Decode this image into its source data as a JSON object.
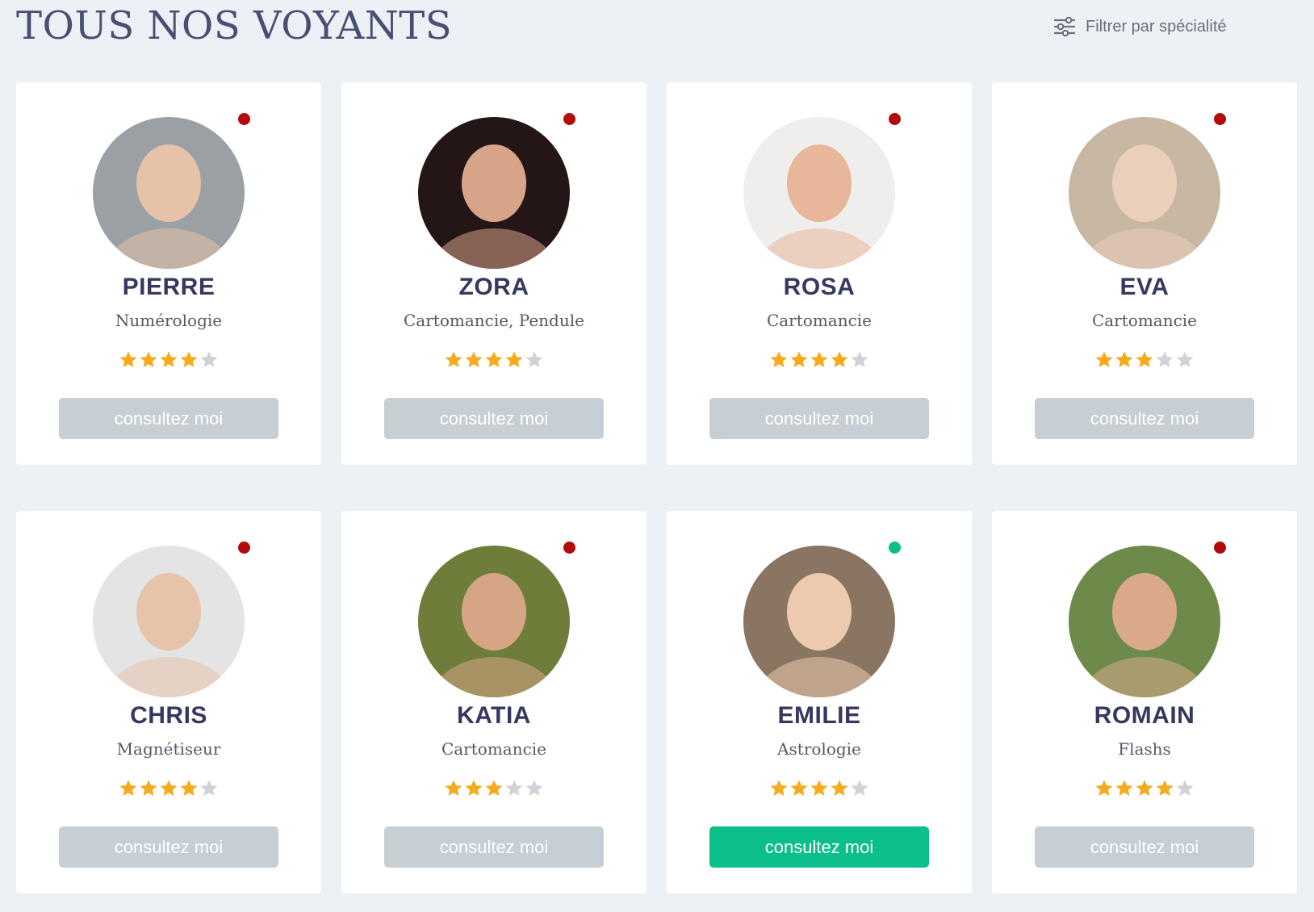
{
  "page": {
    "title": "TOUS NOS VOYANTS"
  },
  "filter": {
    "label": "Filtrer par spécialité",
    "icon": "sliders-icon"
  },
  "colors": {
    "online": "#0bbf8a",
    "offline": "#b30b0b",
    "button_active": "#0bbf8a",
    "button_inactive": "#c7cfd4",
    "star_filled": "#f6aa1c",
    "star_empty": "#cfd3d8"
  },
  "seers": [
    {
      "name": "PIERRE",
      "specialty": "Numérologie",
      "rating": 4,
      "max_rating": 5,
      "status": "offline",
      "button_label": "consultez moi",
      "avatar_color": "#9aa0a4",
      "skin_color": "#e6c2a8"
    },
    {
      "name": "ZORA",
      "specialty": "Cartomancie, Pendule",
      "rating": 4,
      "max_rating": 5,
      "status": "offline",
      "button_label": "consultez moi",
      "avatar_color": "#241617",
      "skin_color": "#d8a488"
    },
    {
      "name": "ROSA",
      "specialty": "Cartomancie",
      "rating": 4,
      "max_rating": 5,
      "status": "offline",
      "button_label": "consultez moi",
      "avatar_color": "#f0eeec",
      "skin_color": "#e8b79a"
    },
    {
      "name": "EVA",
      "specialty": "Cartomancie",
      "rating": 3,
      "max_rating": 5,
      "status": "offline",
      "button_label": "consultez moi",
      "avatar_color": "#c8b7a2",
      "skin_color": "#ead0bb"
    },
    {
      "name": "CHRIS",
      "specialty": "Magnétiseur",
      "rating": 4,
      "max_rating": 5,
      "status": "offline",
      "button_label": "consultez moi",
      "avatar_color": "#e4e4e4",
      "skin_color": "#e7c3a9"
    },
    {
      "name": "KATIA",
      "specialty": "Cartomancie",
      "rating": 3,
      "max_rating": 5,
      "status": "offline",
      "button_label": "consultez moi",
      "avatar_color": "#6f7d3a",
      "skin_color": "#d6a585"
    },
    {
      "name": "EMILIE",
      "specialty": "Astrologie",
      "rating": 4,
      "max_rating": 5,
      "status": "online",
      "button_label": "consultez moi",
      "avatar_color": "#8a7563",
      "skin_color": "#edc9ad"
    },
    {
      "name": "ROMAIN",
      "specialty": "Flashs",
      "rating": 4,
      "max_rating": 5,
      "status": "offline",
      "button_label": "consultez moi",
      "avatar_color": "#6e8a4a",
      "skin_color": "#d9a98a"
    }
  ]
}
